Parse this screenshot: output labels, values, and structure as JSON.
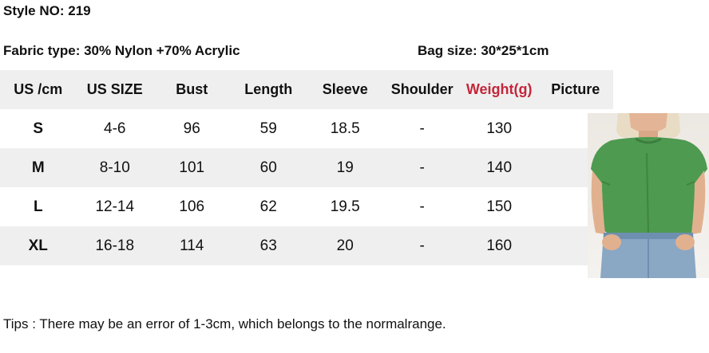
{
  "style_no": "Style NO:  219",
  "fabric_type": "Fabric type:  30% Nylon +70% Acrylic",
  "bag_size": "Bag size:  30*25*1cm",
  "table": {
    "headers": [
      "US /cm",
      "US SIZE",
      "Bust",
      "Length",
      "Sleeve",
      "Shoulder",
      "Weight(g)",
      "Picture"
    ],
    "rows": [
      [
        "S",
        "4-6",
        "96",
        "59",
        "18.5",
        "-",
        "130"
      ],
      [
        "M",
        "8-10",
        "101",
        "60",
        "19",
        "-",
        "140"
      ],
      [
        "L",
        "12-14",
        "106",
        "62",
        "19.5",
        "-",
        "150"
      ],
      [
        "XL",
        "16-18",
        "114",
        "63",
        "20",
        "-",
        "160"
      ]
    ]
  },
  "colors": {
    "weight_header": "#c4263a",
    "row_shade": "#efefef",
    "garment": "#4e9a50"
  },
  "tips": "Tips : There may be an error of 1-3cm, which belongs to the normalrange."
}
